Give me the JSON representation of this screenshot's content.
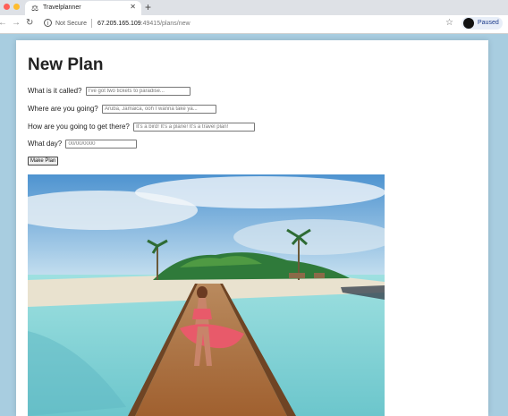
{
  "browser": {
    "tab_title": "Travelplanner",
    "security_label": "Not Secure",
    "url_host": "67.205.165.109",
    "url_path": ":49415/plans/new",
    "profile_status": "Paused"
  },
  "form": {
    "title": "New Plan",
    "fields": [
      {
        "label": "What is it called?",
        "placeholder": "I've got two tickets to paradise..."
      },
      {
        "label": "Where are you going?",
        "placeholder": "Aruba, Jamaica, ooh I wanna take ya..."
      },
      {
        "label": "How are you going to get there?",
        "placeholder": "It's a bird! It's a plane! It's a travel plan!"
      },
      {
        "label": "What day?",
        "placeholder": "00/00/0000"
      }
    ],
    "submit_label": "Make Plan"
  },
  "colors": {
    "page_background": "#a8cde0",
    "sky": "#7ab6e0",
    "sea": "#7fd0d4",
    "dress": "#e85a6a"
  },
  "icons": {
    "tab": "travelplanner-favicon",
    "security": "info-icon",
    "bookmark": "star-icon",
    "back": "back-arrow-icon",
    "forward": "forward-arrow-icon",
    "reload": "reload-icon"
  }
}
